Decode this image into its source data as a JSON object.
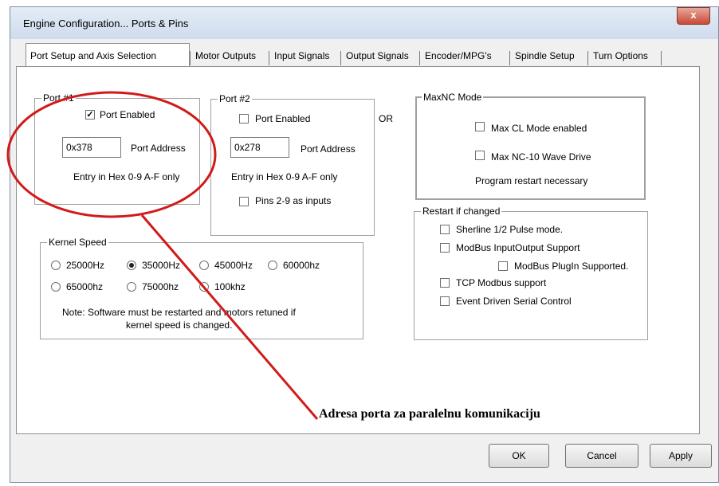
{
  "window": {
    "title": "Engine Configuration... Ports & Pins",
    "close_label": "x"
  },
  "tabs": [
    {
      "label": "Port Setup and Axis Selection"
    },
    {
      "label": "Motor Outputs"
    },
    {
      "label": "Input Signals"
    },
    {
      "label": "Output Signals"
    },
    {
      "label": "Encoder/MPG's"
    },
    {
      "label": "Spindle Setup"
    },
    {
      "label": "Turn Options"
    }
  ],
  "port1": {
    "legend": "Port #1",
    "enabled_label": "Port Enabled",
    "enabled": true,
    "address_value": "0x378",
    "address_label": "Port Address",
    "hint": "Entry in Hex 0-9 A-F only"
  },
  "port2": {
    "legend": "Port #2",
    "enabled_label": "Port Enabled",
    "enabled": false,
    "address_value": "0x278",
    "address_label": "Port Address",
    "hint": "Entry in Hex 0-9 A-F only",
    "pins_label": "Pins 2-9 as inputs"
  },
  "or_label": "OR",
  "maxnc": {
    "legend": "MaxNC Mode",
    "cl_label": "Max CL Mode enabled",
    "nc10_label": "Max NC-10 Wave Drive",
    "note": "Program restart necessary"
  },
  "restart": {
    "legend": "Restart if changed",
    "items": [
      {
        "label": "Sherline 1/2 Pulse mode."
      },
      {
        "label": "ModBus InputOutput Support"
      },
      {
        "label": "ModBus PlugIn Supported."
      },
      {
        "label": "TCP Modbus support"
      },
      {
        "label": "Event Driven Serial Control"
      }
    ]
  },
  "kernel": {
    "legend": "Kernel Speed",
    "options": [
      {
        "label": "25000Hz",
        "selected": false
      },
      {
        "label": "35000Hz",
        "selected": true
      },
      {
        "label": "45000Hz",
        "selected": false
      },
      {
        "label": "60000hz",
        "selected": false
      },
      {
        "label": "65000hz",
        "selected": false
      },
      {
        "label": "75000hz",
        "selected": false
      },
      {
        "label": "100khz",
        "selected": false
      }
    ],
    "note_line1": "Note: Software must be restarted and motors retuned if",
    "note_line2": "kernel speed is changed."
  },
  "buttons": {
    "ok": "OK",
    "cancel": "Cancel",
    "apply": "Apply"
  },
  "annotation": {
    "text": "Adresa porta za paralelnu komunikaciju",
    "color": "#d11a1a"
  },
  "colors": {
    "accent_red": "#d11a1a",
    "close_button": "#c74a37"
  }
}
